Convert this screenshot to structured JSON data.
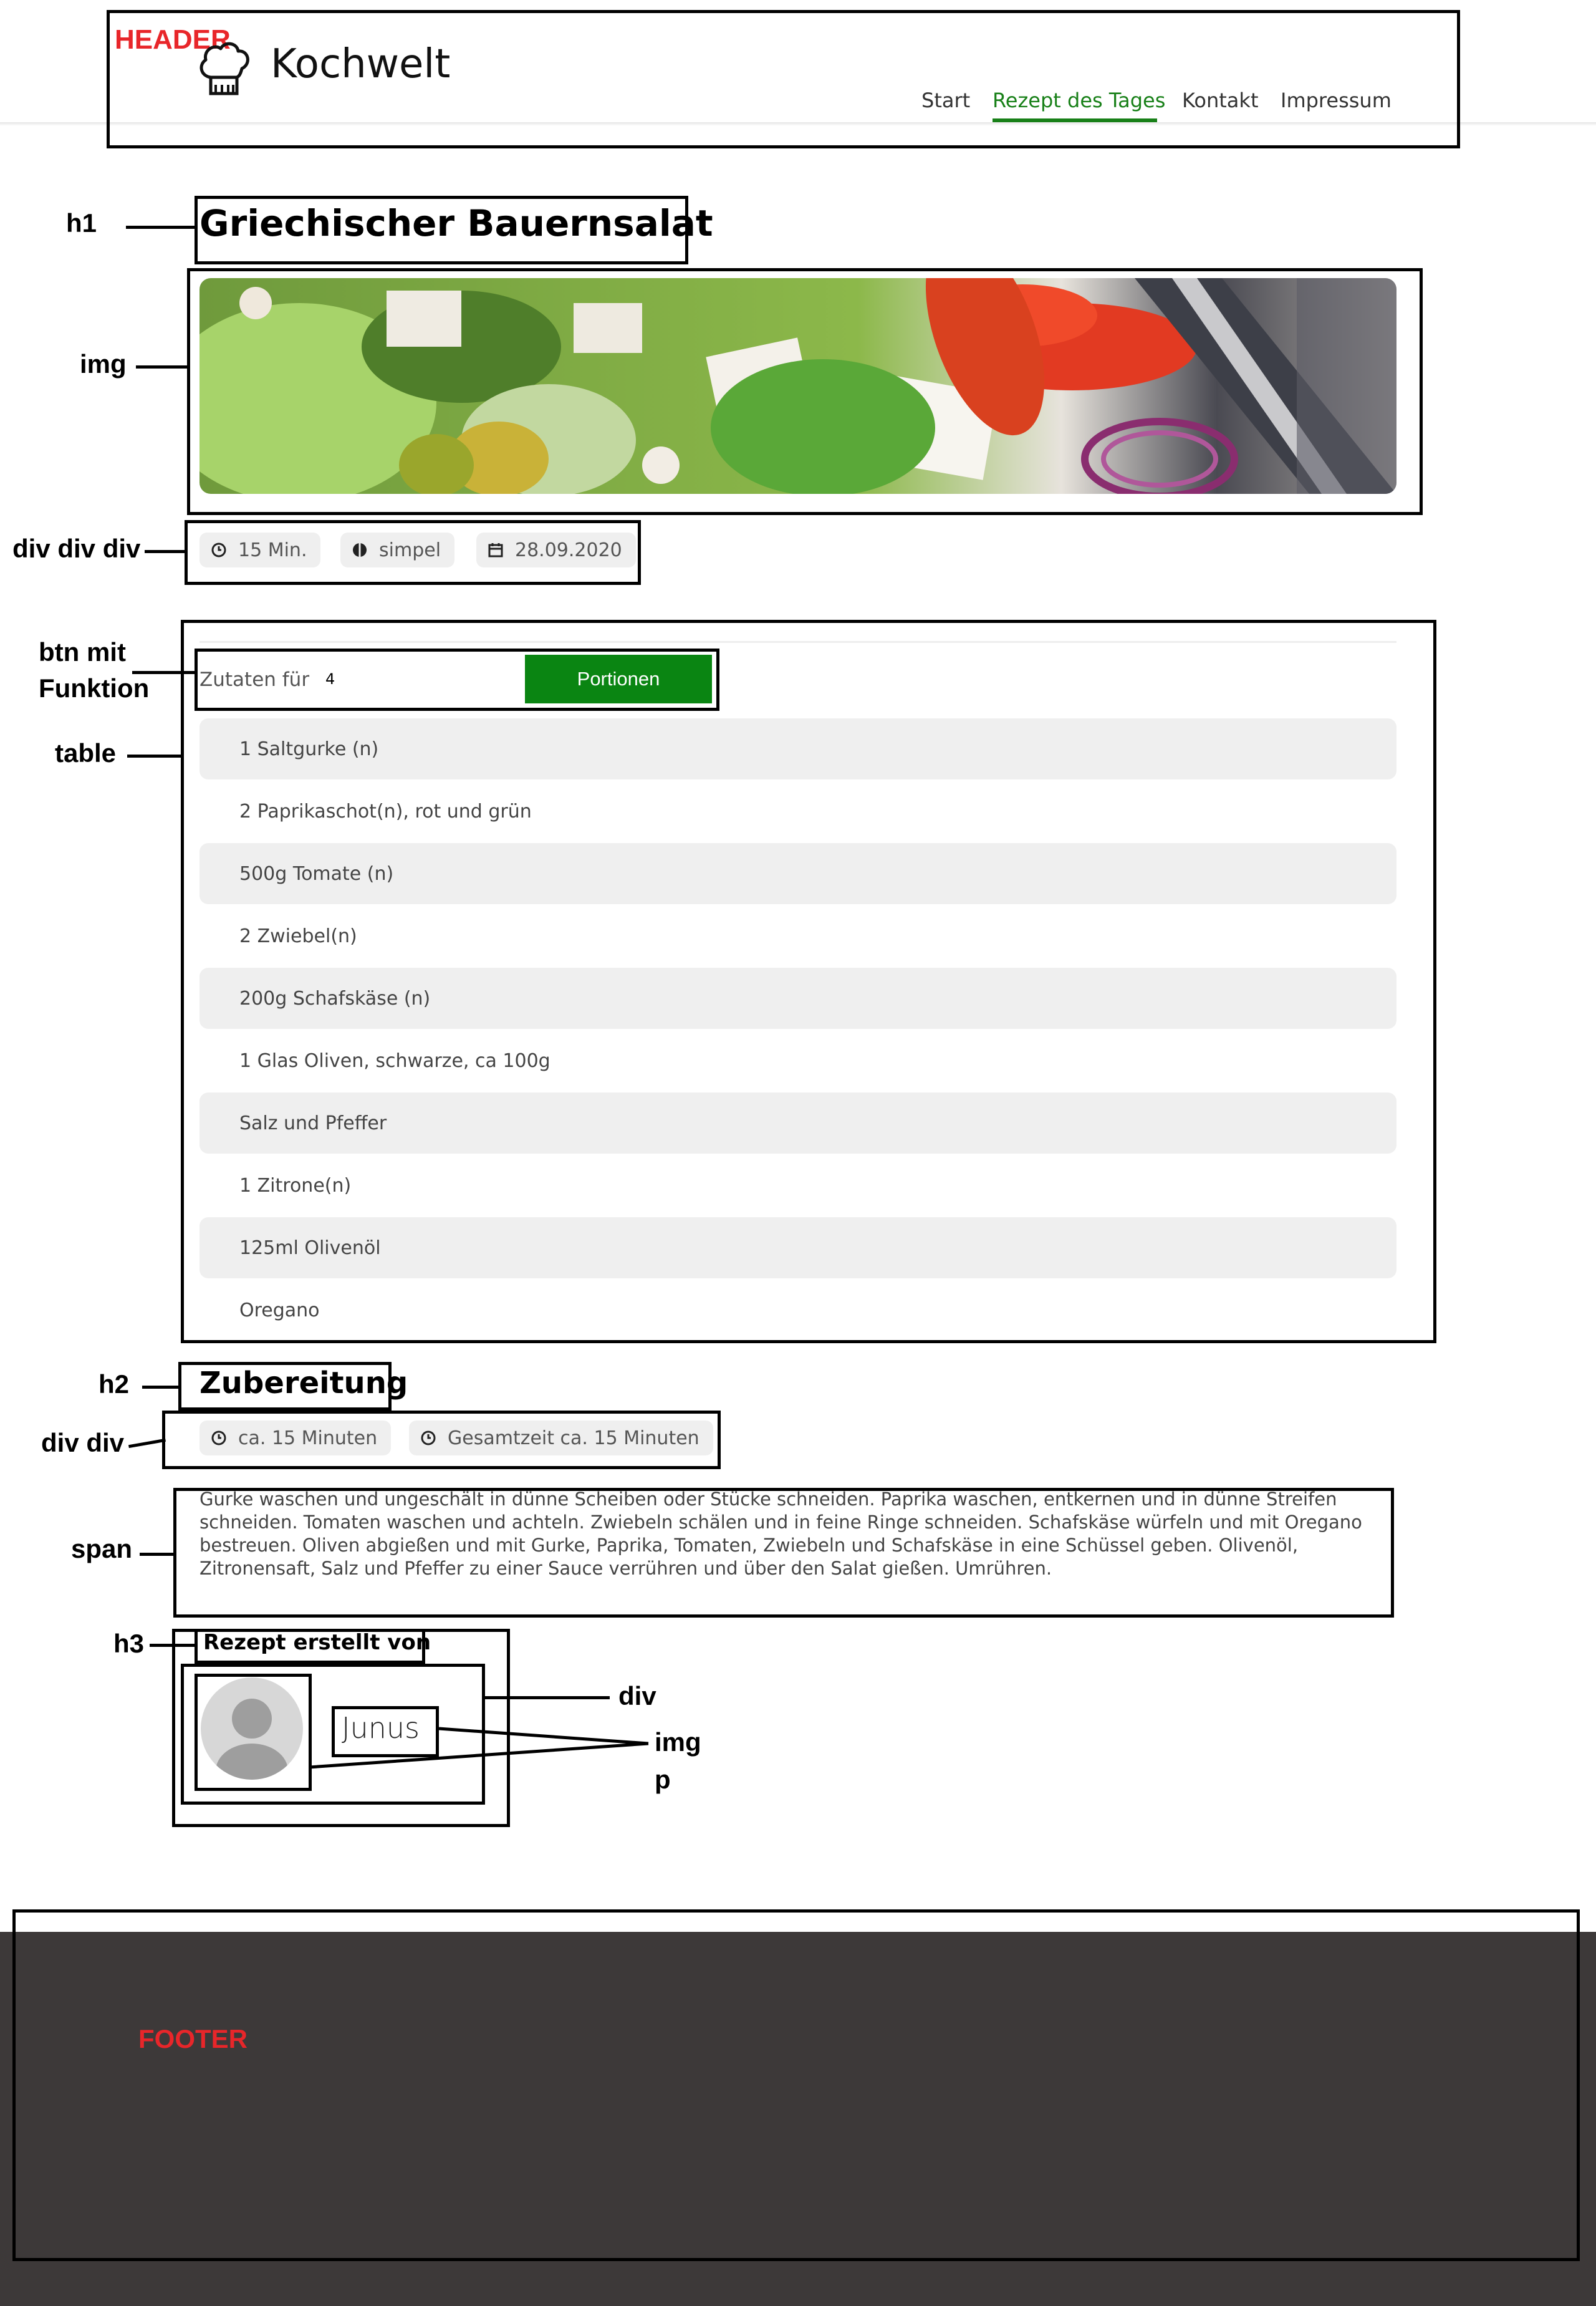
{
  "annotations": {
    "header": "HEADER",
    "h1": "h1",
    "img": "img",
    "meta": "div div div",
    "btn_line1": "btn mit",
    "btn_line2": "Funktion",
    "table": "table",
    "h2": "h2",
    "prep_meta": "div div",
    "span": "span",
    "h3": "h3",
    "div": "div",
    "img2": "img",
    "p": "p",
    "footer": "FOOTER"
  },
  "header": {
    "brand": "Kochwelt",
    "logo_icon": "chef-hat-icon",
    "nav": [
      {
        "label": "Start",
        "active": false
      },
      {
        "label": "Rezept des Tages",
        "active": true
      },
      {
        "label": "Kontakt",
        "active": false
      },
      {
        "label": "Impressum",
        "active": false
      }
    ],
    "active_color": "#188018"
  },
  "recipe": {
    "title": "Griechischer Bauernsalat",
    "image_alt": "greek-salad-photo",
    "meta": [
      {
        "icon": "clock-icon",
        "text": "15 Min."
      },
      {
        "icon": "difficulty-icon",
        "text": "simpel"
      },
      {
        "icon": "calendar-icon",
        "text": "28.09.2020"
      }
    ]
  },
  "ingredients": {
    "label": "Zutaten für",
    "servings": "4",
    "button": "Portionen",
    "button_color": "#0a8512",
    "items": [
      "1 Saltgurke (n)",
      "2 Paprikaschot(n), rot und grün",
      "500g Tomate (n)",
      "2 Zwiebel(n)",
      "200g Schafskäse (n)",
      "1 Glas Oliven, schwarze, ca 100g",
      "Salz und Pfeffer",
      "1 Zitrone(n)",
      "125ml Olivenöl",
      "Oregano"
    ]
  },
  "preparation": {
    "heading": "Zubereitung",
    "meta": [
      {
        "icon": "clock-icon",
        "text": "ca. 15 Minuten"
      },
      {
        "icon": "clock-icon",
        "text": "Gesamtzeit ca. 15 Minuten"
      }
    ],
    "lines": [
      "Gurke waschen und ungeschält in dünne Scheiben oder Stücke schneiden. Paprika waschen, entkernen und in dünne Streifen",
      "schneiden. Tomaten waschen und achteln. Zwiebeln schälen und in feine Ringe schneiden. Schafskäse würfeln und mit Oregano",
      "bestreuen. Oliven abgießen und mit Gurke, Paprika, Tomaten, Zwiebeln und Schafskäse in eine Schüssel geben. Olivenöl,",
      "Zitronensaft, Salz und Pfeffer zu einer Sauce verrühren und über den Salat gießen. Umrühren."
    ]
  },
  "author": {
    "heading": "Rezept erstellt von",
    "name": "Junus",
    "avatar_icon": "user-avatar-icon"
  },
  "footer": {
    "background": "#3d3939"
  }
}
